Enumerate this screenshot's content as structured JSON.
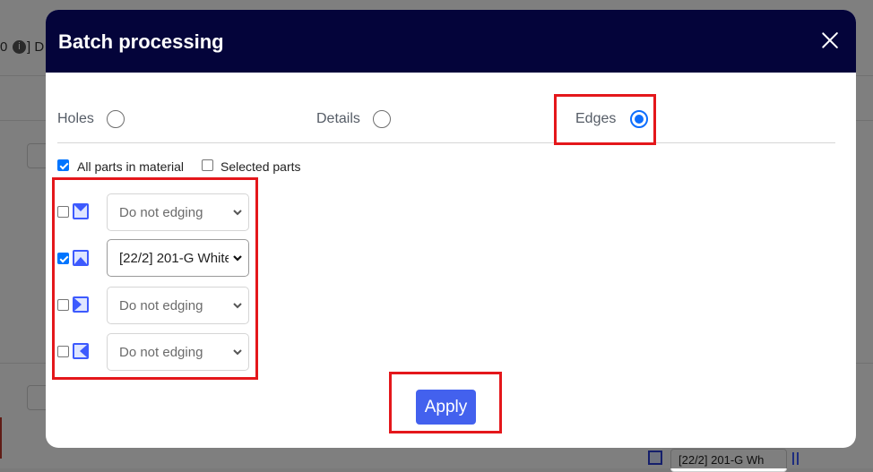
{
  "background": {
    "left_fragment": "0",
    "left_fragment_letter": "] D",
    "bottom_select_value": "[22/2] 201-G Wh"
  },
  "modal": {
    "title": "Batch processing",
    "close_icon": "close-icon"
  },
  "tabs": {
    "holes": "Holes",
    "details": "Details",
    "edges": "Edges",
    "selected": "edges"
  },
  "scope": {
    "all_parts_label": "All parts in material",
    "all_parts_checked": true,
    "selected_parts_label": "Selected parts",
    "selected_parts_checked": false
  },
  "edges": [
    {
      "side": "top",
      "icon": "edge-top-icon",
      "checked": false,
      "value": "Do not edging"
    },
    {
      "side": "bottom",
      "icon": "edge-bottom-icon",
      "checked": true,
      "value": "[22/2] 201-G White"
    },
    {
      "side": "right",
      "icon": "edge-right-icon",
      "checked": false,
      "value": "Do not edging"
    },
    {
      "side": "left",
      "icon": "edge-left-icon",
      "checked": false,
      "value": "Do not edging"
    }
  ],
  "apply_label": "Apply",
  "colors": {
    "header": "#04043a",
    "accent": "#4361ee",
    "radio_selected": "#0d6efd",
    "highlight": "#e4171b"
  }
}
